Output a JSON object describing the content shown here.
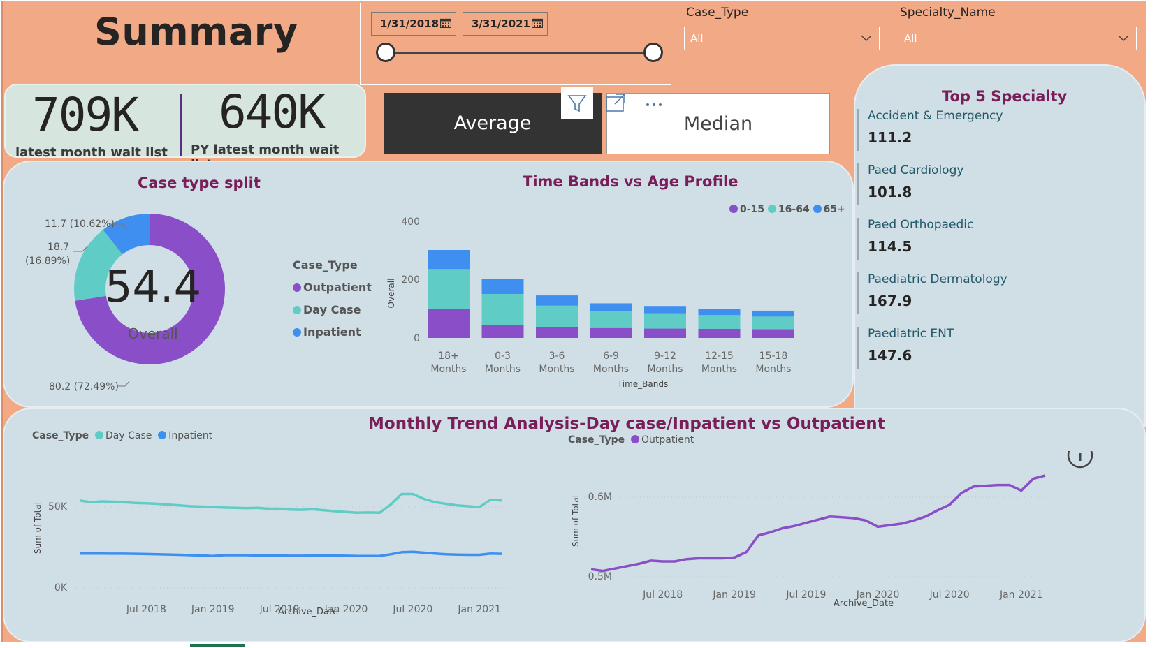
{
  "page": {
    "title": "Summary"
  },
  "date_slicer": {
    "start": "1/31/2018",
    "end": "3/31/2021"
  },
  "filters": [
    {
      "label": "Case_Type",
      "value": "All"
    },
    {
      "label": "Specialty_Name",
      "value": "All"
    }
  ],
  "kpis": [
    {
      "value": "709K",
      "label": "latest month wait list"
    },
    {
      "value": "640K",
      "label": "PY latest month wait list"
    }
  ],
  "toggle": {
    "average": "Average",
    "median": "Median"
  },
  "header_tools": [
    "filter-icon",
    "focus-mode-icon",
    "more-options-icon"
  ],
  "colors": {
    "outpatient": "#8a4fc8",
    "day_case": "#5fccc5",
    "inpatient": "#3f8ff0",
    "title": "#7a1e59",
    "panel": "#d0dfe5",
    "background": "#f2a986"
  },
  "top5": {
    "title": "Top 5 Specialty",
    "items": [
      {
        "name": "Accident & Emergency",
        "value": "111.2"
      },
      {
        "name": "Paed Cardiology",
        "value": "101.8"
      },
      {
        "name": "Paed Orthopaedic",
        "value": "114.5"
      },
      {
        "name": "Paediatric Dermatology",
        "value": "167.9"
      },
      {
        "name": "Paediatric ENT",
        "value": "147.6"
      }
    ]
  },
  "donut": {
    "title": "Case type split",
    "center_value": "54.4",
    "center_label": "Overall",
    "legend_title": "Case_Type",
    "legend": [
      "Outpatient",
      "Day Case",
      "Inpatient"
    ],
    "labels": {
      "inpatient": "11.7 (10.62%)",
      "day_case_value": "18.7",
      "day_case_pct": "(16.89%)",
      "outpatient": "80.2 (72.49%)"
    }
  },
  "bar": {
    "title": "Time Bands vs Age Profile",
    "legend": [
      "0-15",
      "16-64",
      "65+"
    ],
    "ylabel": "Overall",
    "xlabel": "Time_Bands",
    "yticks": [
      "0",
      "200",
      "400"
    ]
  },
  "trend": {
    "title": "Monthly Trend Analysis-Day case/Inpatient vs Outpatient",
    "left": {
      "legend_title": "Case_Type",
      "legend": [
        "Day Case",
        "Inpatient"
      ],
      "ylabel": "Sum of Total",
      "xlabel": "Archive_Date",
      "yticks": [
        "0K",
        "50K"
      ],
      "xticks": [
        "Jul 2018",
        "Jan 2019",
        "Jul 2019",
        "Jan 2020",
        "Jul 2020",
        "Jan 2021"
      ]
    },
    "right": {
      "legend_title": "Case_Type",
      "legend": [
        "Outpatient"
      ],
      "ylabel": "Sum of Total",
      "xlabel": "Archive_Date",
      "yticks": [
        "0.5M",
        "0.6M"
      ],
      "xticks": [
        "Jul 2018",
        "Jan 2019",
        "Jul 2019",
        "Jan 2020",
        "Jul 2020",
        "Jan 2021"
      ]
    }
  },
  "chart_data": [
    {
      "type": "pie",
      "title": "Case type split",
      "categories": [
        "Outpatient",
        "Day Case",
        "Inpatient"
      ],
      "values": [
        80.2,
        18.7,
        11.7
      ],
      "percent": [
        72.49,
        16.89,
        10.62
      ]
    },
    {
      "type": "bar",
      "stacked": true,
      "title": "Time Bands vs Age Profile",
      "xlabel": "Time_Bands",
      "ylabel": "Overall",
      "ylim": [
        0,
        400
      ],
      "categories": [
        [
          "18+",
          "Months"
        ],
        [
          "0-3",
          "Months"
        ],
        [
          "3-6",
          "Months"
        ],
        [
          "6-9",
          "Months"
        ],
        [
          "9-12",
          "Months"
        ],
        [
          "12-15",
          "Months"
        ],
        [
          "15-18",
          "Months"
        ]
      ],
      "series": [
        {
          "name": "0-15",
          "values": [
            100,
            45,
            38,
            34,
            32,
            31,
            30
          ]
        },
        {
          "name": "16-64",
          "values": [
            135,
            105,
            72,
            57,
            52,
            47,
            43
          ]
        },
        {
          "name": "65+",
          "values": [
            65,
            52,
            35,
            27,
            25,
            22,
            20
          ]
        }
      ],
      "legend_position": "top-right"
    },
    {
      "type": "line",
      "title": "Monthly Trend Analysis-Day case/Inpatient vs Outpatient",
      "xlabel": "Archive_Date",
      "ylabel": "Sum of Total",
      "ylim": [
        0,
        75000
      ],
      "x": [
        "2018-01",
        "2018-02",
        "2018-03",
        "2018-04",
        "2018-05",
        "2018-06",
        "2018-07",
        "2018-08",
        "2018-09",
        "2018-10",
        "2018-11",
        "2018-12",
        "2019-01",
        "2019-02",
        "2019-03",
        "2019-04",
        "2019-05",
        "2019-06",
        "2019-07",
        "2019-08",
        "2019-09",
        "2019-10",
        "2019-11",
        "2019-12",
        "2020-01",
        "2020-02",
        "2020-03",
        "2020-04",
        "2020-05",
        "2020-06",
        "2020-07",
        "2020-08",
        "2020-09",
        "2020-10",
        "2020-11",
        "2020-12",
        "2021-01",
        "2021-02",
        "2021-03"
      ],
      "series": [
        {
          "name": "Day Case",
          "values": [
            57500,
            56500,
            57000,
            56800,
            56500,
            56000,
            55800,
            55500,
            55000,
            54500,
            54000,
            53800,
            53500,
            53200,
            53000,
            52800,
            53000,
            52500,
            52500,
            52000,
            51800,
            52200,
            51500,
            51000,
            50500,
            50000,
            50200,
            50000,
            55000,
            61500,
            61500,
            58500,
            56500,
            55500,
            54500,
            54000,
            53500,
            58000,
            57500
          ]
        },
        {
          "name": "Inpatient",
          "values": [
            25000,
            25000,
            25000,
            24900,
            24900,
            24800,
            24700,
            24500,
            24400,
            24200,
            24000,
            23800,
            23500,
            24000,
            24000,
            24000,
            23800,
            23800,
            23800,
            23600,
            23600,
            23700,
            23700,
            23700,
            23600,
            23500,
            23500,
            23500,
            24500,
            25800,
            26000,
            25500,
            25000,
            24500,
            24300,
            24200,
            24200,
            25000,
            24800
          ]
        }
      ]
    },
    {
      "type": "line",
      "xlabel": "Archive_Date",
      "ylabel": "Sum of Total",
      "ylim": [
        0.49,
        0.63
      ],
      "x": [
        "2018-01",
        "2018-02",
        "2018-03",
        "2018-04",
        "2018-05",
        "2018-06",
        "2018-07",
        "2018-08",
        "2018-09",
        "2018-10",
        "2018-11",
        "2018-12",
        "2019-01",
        "2019-02",
        "2019-03",
        "2019-04",
        "2019-05",
        "2019-06",
        "2019-07",
        "2019-08",
        "2019-09",
        "2019-10",
        "2019-11",
        "2019-12",
        "2020-01",
        "2020-02",
        "2020-03",
        "2020-04",
        "2020-05",
        "2020-06",
        "2020-07",
        "2020-08",
        "2020-09",
        "2020-10",
        "2020-11",
        "2020-12",
        "2021-01",
        "2021-02",
        "2021-03"
      ],
      "series": [
        {
          "name": "Outpatient",
          "values": [
            0.503,
            0.501,
            0.504,
            0.507,
            0.51,
            0.514,
            0.513,
            0.513,
            0.516,
            0.517,
            0.517,
            0.517,
            0.518,
            0.525,
            0.546,
            0.55,
            0.555,
            0.558,
            0.562,
            0.566,
            0.57,
            0.569,
            0.568,
            0.565,
            0.557,
            0.559,
            0.561,
            0.565,
            0.57,
            0.578,
            0.585,
            0.6,
            0.608,
            0.609,
            0.61,
            0.61,
            0.603,
            0.618,
            0.622
          ]
        }
      ]
    }
  ]
}
